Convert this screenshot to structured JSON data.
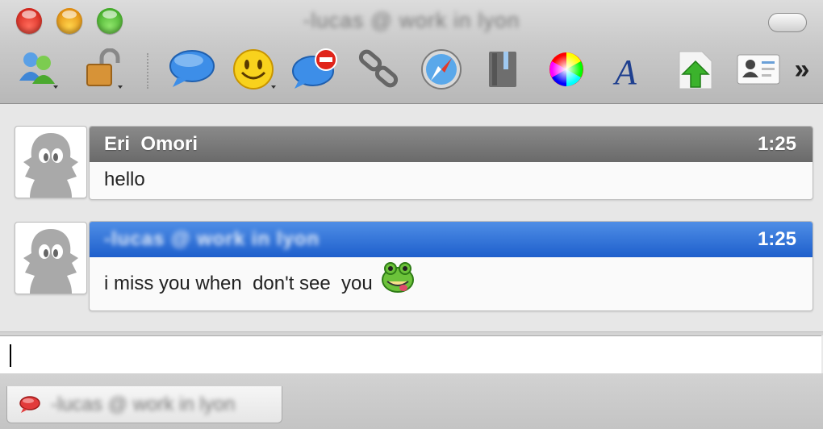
{
  "window": {
    "title": "-lucas @ work in lyon"
  },
  "toolbar": {
    "items": [
      {
        "name": "contacts-icon"
      },
      {
        "name": "lock-icon"
      },
      {
        "name": "speech-bubble-icon"
      },
      {
        "name": "smiley-icon"
      },
      {
        "name": "block-icon"
      },
      {
        "name": "link-icon"
      },
      {
        "name": "compass-icon"
      },
      {
        "name": "notebook-icon"
      },
      {
        "name": "color-wheel-icon"
      },
      {
        "name": "font-icon"
      },
      {
        "name": "upload-icon"
      },
      {
        "name": "contact-card-icon"
      }
    ],
    "overflow": "»"
  },
  "messages": [
    {
      "sender": "Eri  Omori",
      "time": "1:25",
      "text": "hello",
      "header_style": "gray"
    },
    {
      "sender": "-lucas @ work in lyon",
      "time": "1:25",
      "text": "i miss you when  don't see  you",
      "header_style": "blue",
      "emoji": "frog-emoticon-icon"
    }
  ],
  "input": {
    "value": ""
  },
  "tabs": [
    {
      "label": "-lucas @ work in lyon",
      "icon": "speech-bubble-icon"
    }
  ]
}
